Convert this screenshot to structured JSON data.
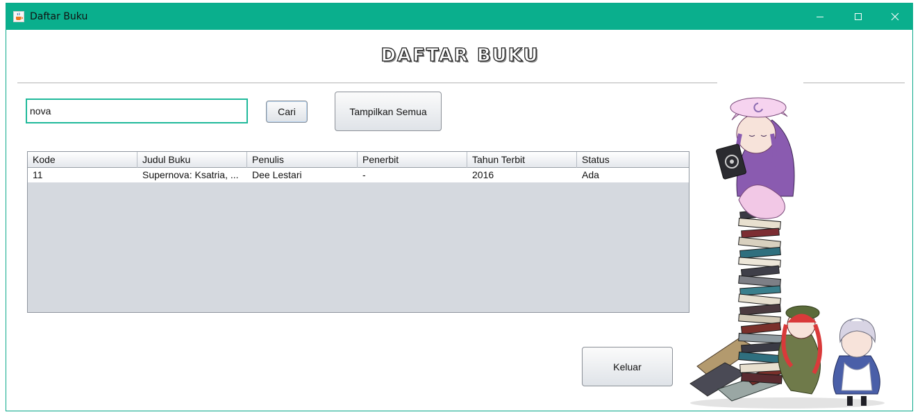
{
  "window": {
    "title": "Daftar Buku",
    "icon": "java-cup-icon"
  },
  "titlebar_buttons": {
    "minimize": "minimize-icon",
    "maximize": "maximize-icon",
    "close": "close-icon"
  },
  "page": {
    "heading": "DAFTAR BUKU"
  },
  "search": {
    "value": "nova",
    "button": "Cari"
  },
  "show_all_button": "Tampilkan Semua",
  "table": {
    "columns": [
      "Kode",
      "Judul Buku",
      "Penulis",
      "Penerbit",
      "Tahun Terbit",
      "Status"
    ],
    "rows": [
      [
        "11",
        "Supernova: Ksatria, ...",
        "Dee Lestari",
        "-",
        "2016",
        "Ada"
      ]
    ]
  },
  "exit_button": "Keluar",
  "colors": {
    "titlebar": "#0aaf8d",
    "input_border": "#1fb99a",
    "table_empty": "#d5d9df"
  }
}
